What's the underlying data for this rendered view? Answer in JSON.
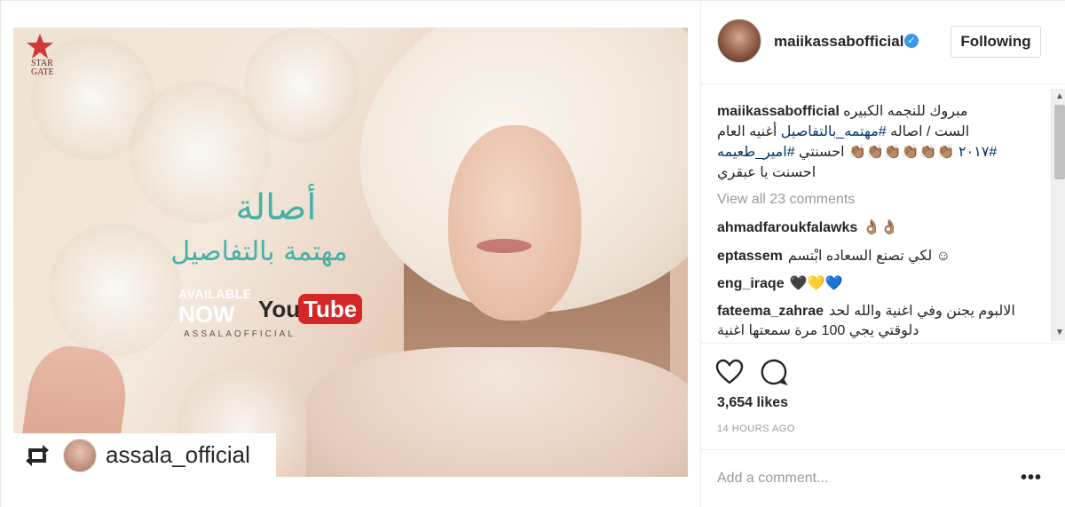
{
  "post": {
    "author": "maiikassabofficial",
    "follow_label": "Following",
    "view_all_comments": "View all 23 comments",
    "likes": "3,654 likes",
    "time_ago": "14 HOURS AGO",
    "add_comment_placeholder": "Add a comment...",
    "more_label": "•••"
  },
  "caption": {
    "user": "maiikassabofficial",
    "line1": "مبروك للنجمه الكبيره",
    "line2_plain": "الست / اصاله ",
    "line2_tag": "#مهتمه_بالتفاصيل",
    "line2_end": " أغنيه العام",
    "line3_tag1": "#٢٠١٧",
    "line3_emoji": " 👏🏽👏🏽👏🏽👏🏽👏🏽👏🏽 احسنتي ",
    "line3_tag2": "#امير_طعيمه",
    "line4": "احسنت يا عبقري"
  },
  "comments": [
    {
      "user": "ahmadfaroukfalawks",
      "text": "👌🏽👌🏽"
    },
    {
      "user": "eptassem",
      "text": "لكي تصنع السعاده ابْتسم ☺"
    },
    {
      "user": "eng_iraqe",
      "text": "🖤💛💙"
    },
    {
      "user": "fateema_zahrae",
      "text": "الالبوم يجنن وفي اغنية والله لحد دلوقتي يجي 100 مرة سمعتها اغنية"
    }
  ],
  "media": {
    "logo_text_1": "STAR",
    "logo_text_2": "GATE",
    "arabic_title": "أصالة",
    "arabic_subtitle": "مهتمة بالتفاصيل",
    "available": "AVAILABLE",
    "now": "NOW",
    "yt_you": "You",
    "yt_tube": "Tube",
    "channel": "ASSALAOFFICIAL",
    "repost_user": "assala_official"
  },
  "colors": {
    "verified_blue": "#3897f0",
    "hashtag": "#003569",
    "arabic_teal": "#46b1a7",
    "youtube_red": "#d62728"
  }
}
